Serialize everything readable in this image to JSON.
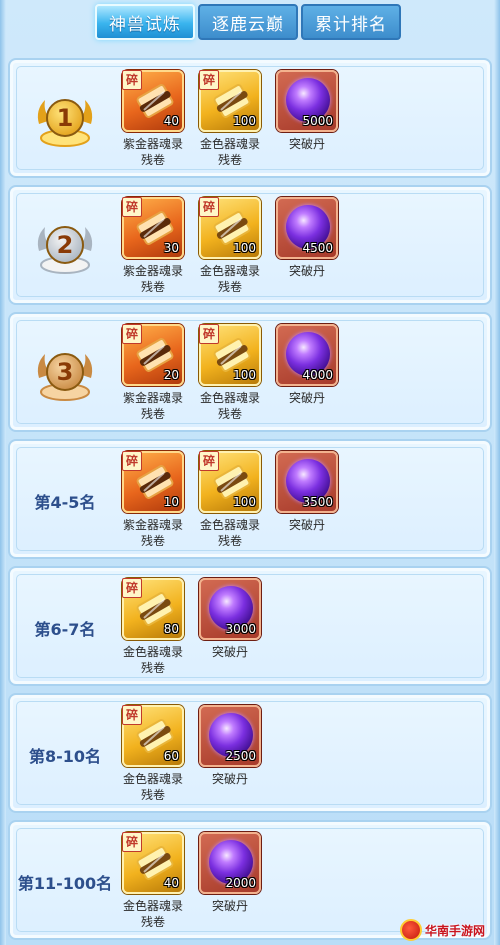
{
  "tabs": [
    {
      "label": "神兽试炼",
      "active": true
    },
    {
      "label": "逐鹿云巅",
      "active": false
    },
    {
      "label": "累计排名",
      "active": false
    }
  ],
  "colors": {
    "rank_text": "#2d4f8c",
    "active_tab": "#39b4ee",
    "tab": "#3d8dcc"
  },
  "rows": [
    {
      "rank_medal": "1",
      "rank_label": "",
      "items": [
        {
          "type": "purple-gold-scroll",
          "badge": "碎",
          "qty": "40",
          "name_line1": "紫金器魂录",
          "name_line2": "残卷"
        },
        {
          "type": "gold-scroll",
          "badge": "碎",
          "qty": "100",
          "name_line1": "金色器魂录",
          "name_line2": "残卷"
        },
        {
          "type": "breakthrough-pill",
          "badge": "",
          "qty": "5000",
          "name_line1": "突破丹",
          "name_line2": ""
        }
      ]
    },
    {
      "rank_medal": "2",
      "rank_label": "",
      "items": [
        {
          "type": "purple-gold-scroll",
          "badge": "碎",
          "qty": "30",
          "name_line1": "紫金器魂录",
          "name_line2": "残卷"
        },
        {
          "type": "gold-scroll",
          "badge": "碎",
          "qty": "100",
          "name_line1": "金色器魂录",
          "name_line2": "残卷"
        },
        {
          "type": "breakthrough-pill",
          "badge": "",
          "qty": "4500",
          "name_line1": "突破丹",
          "name_line2": ""
        }
      ]
    },
    {
      "rank_medal": "3",
      "rank_label": "",
      "items": [
        {
          "type": "purple-gold-scroll",
          "badge": "碎",
          "qty": "20",
          "name_line1": "紫金器魂录",
          "name_line2": "残卷"
        },
        {
          "type": "gold-scroll",
          "badge": "碎",
          "qty": "100",
          "name_line1": "金色器魂录",
          "name_line2": "残卷"
        },
        {
          "type": "breakthrough-pill",
          "badge": "",
          "qty": "4000",
          "name_line1": "突破丹",
          "name_line2": ""
        }
      ]
    },
    {
      "rank_medal": "",
      "rank_label": "第4-5名",
      "items": [
        {
          "type": "purple-gold-scroll",
          "badge": "碎",
          "qty": "10",
          "name_line1": "紫金器魂录",
          "name_line2": "残卷"
        },
        {
          "type": "gold-scroll",
          "badge": "碎",
          "qty": "100",
          "name_line1": "金色器魂录",
          "name_line2": "残卷"
        },
        {
          "type": "breakthrough-pill",
          "badge": "",
          "qty": "3500",
          "name_line1": "突破丹",
          "name_line2": ""
        }
      ]
    },
    {
      "rank_medal": "",
      "rank_label": "第6-7名",
      "items": [
        {
          "type": "gold-scroll",
          "badge": "碎",
          "qty": "80",
          "name_line1": "金色器魂录",
          "name_line2": "残卷"
        },
        {
          "type": "breakthrough-pill",
          "badge": "",
          "qty": "3000",
          "name_line1": "突破丹",
          "name_line2": ""
        }
      ]
    },
    {
      "rank_medal": "",
      "rank_label": "第8-10名",
      "items": [
        {
          "type": "gold-scroll",
          "badge": "碎",
          "qty": "60",
          "name_line1": "金色器魂录",
          "name_line2": "残卷"
        },
        {
          "type": "breakthrough-pill",
          "badge": "",
          "qty": "2500",
          "name_line1": "突破丹",
          "name_line2": ""
        }
      ]
    },
    {
      "rank_medal": "",
      "rank_label": "第11-100名",
      "items": [
        {
          "type": "gold-scroll",
          "badge": "碎",
          "qty": "40",
          "name_line1": "金色器魂录",
          "name_line2": "残卷"
        },
        {
          "type": "breakthrough-pill",
          "badge": "",
          "qty": "2000",
          "name_line1": "突破丹",
          "name_line2": ""
        }
      ]
    }
  ],
  "watermark": {
    "text": "华南手游网"
  }
}
